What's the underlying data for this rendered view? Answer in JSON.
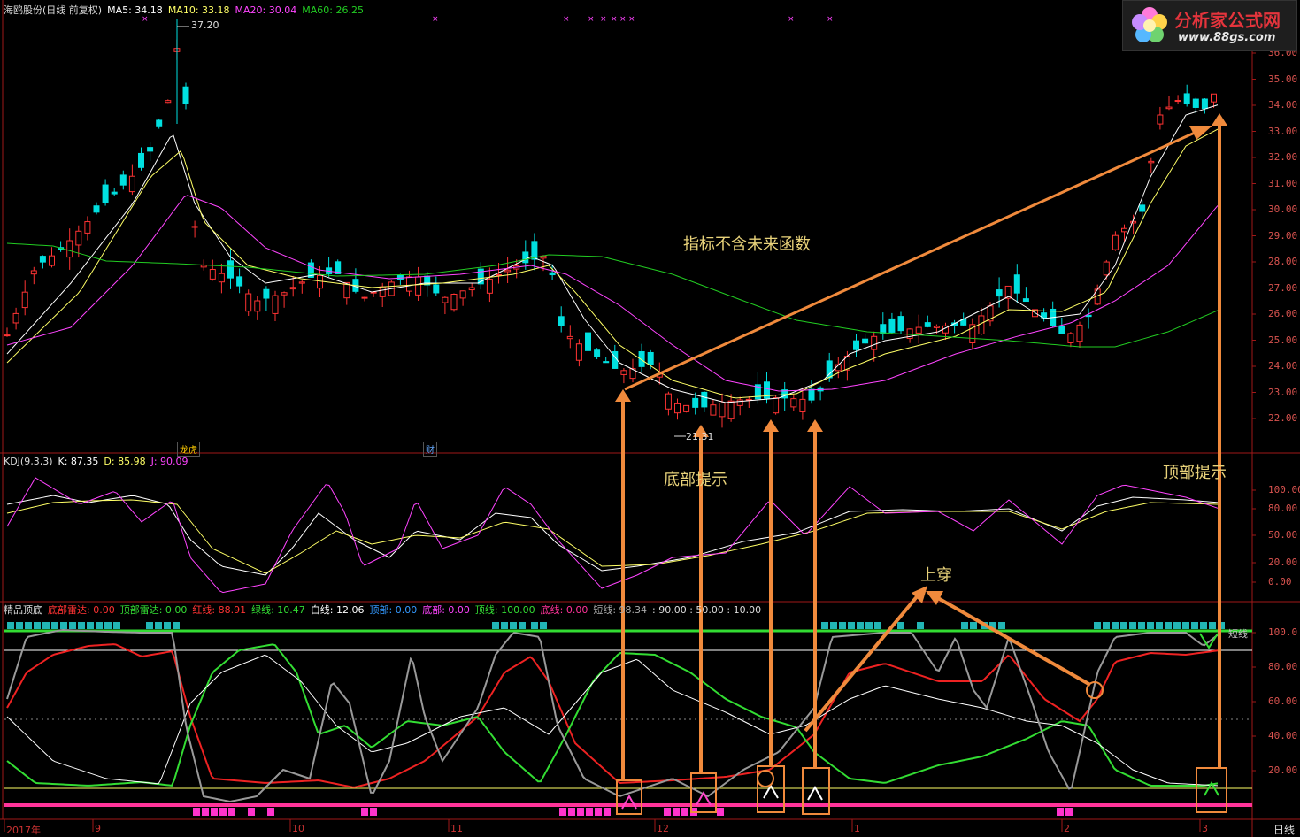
{
  "window": {
    "title": "海鸥股份(日线 前复权)",
    "period_label": "日线"
  },
  "logo": {
    "brand": "分析家公式网",
    "url": "www.88gs.com"
  },
  "main_panel": {
    "ma5_label": "MA5: 34.18",
    "ma10_label": "MA10: 33.18",
    "ma20_label": "MA20: 30.04",
    "ma60_label": "MA60: 26.25",
    "high_marker": "37.20",
    "low_marker": "21.31",
    "price_axis": [
      "36.00",
      "35.00",
      "34.00",
      "33.00",
      "32.00",
      "31.00",
      "30.00",
      "29.00",
      "28.00",
      "27.00",
      "26.00",
      "25.00",
      "24.00",
      "23.00",
      "22.00"
    ],
    "tag_dragon": "龙虎",
    "tag_finance": "财"
  },
  "kdj_panel": {
    "title": "KDJ(9,3,3)",
    "k_label": "K: 87.35",
    "d_label": "D: 85.98",
    "j_label": "J: 90.09",
    "axis": [
      "100.00",
      "80.00",
      "50.00",
      "20.00",
      "0.00"
    ]
  },
  "top_bottom_panel": {
    "title": "精品顶底",
    "bottom_radar": "底部雷达: 0.00",
    "top_radar": "顶部雷达: 0.00",
    "red_line": "红线: 88.91",
    "green_line": "绿线: 10.47",
    "white_line": "白线: 12.06",
    "top": "顶部: 0.00",
    "bottom": "底部: 0.00",
    "top_line": "顶线: 100.00",
    "bottom_line": "底线: 0.00",
    "short_line": "短线: 98.34",
    "levels": ": 90.00 : 50.00 : 10.00",
    "short_line_tag": "短线",
    "axis": [
      "100.0",
      "80.00",
      "60.00",
      "40.00",
      "20.00"
    ]
  },
  "annotations": {
    "no_future": "指标不含未来函数",
    "bottom_hint": "底部提示",
    "top_hint": "顶部提示",
    "cross_up": "上穿"
  },
  "x_axis": {
    "ticks": [
      "2017年",
      "9",
      "10",
      "11",
      "12",
      "1",
      "2",
      "3"
    ]
  },
  "colors": {
    "ma5": "#ffffff",
    "ma10": "#ffff66",
    "ma20": "#ff44ff",
    "ma60": "#22cc22",
    "up": "#ff3333",
    "down": "#00e0e0",
    "annotation": "#f08a3c"
  }
}
